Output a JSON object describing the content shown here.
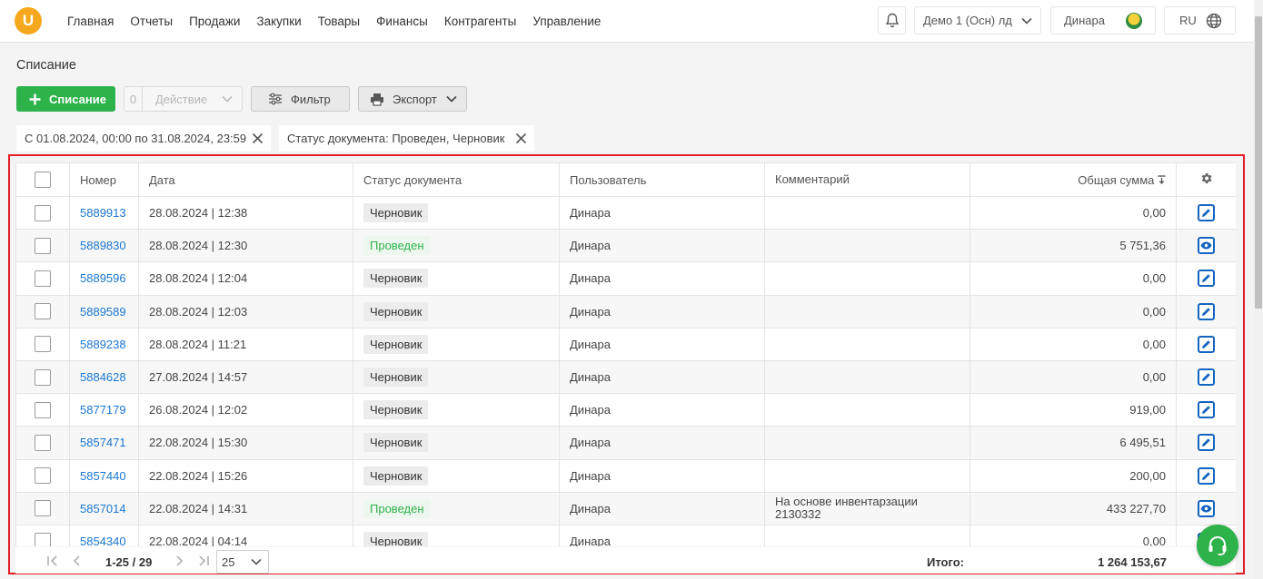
{
  "nav": [
    "Главная",
    "Отчеты",
    "Продажи",
    "Закупки",
    "Товары",
    "Финансы",
    "Контрагенты",
    "Управление"
  ],
  "header": {
    "logo": "U",
    "company": "Демо 1 (Осн) лд",
    "user": "Динара",
    "lang": "RU"
  },
  "page_title": "Списание",
  "toolbar": {
    "add_label": "Списание",
    "action_count": "0",
    "action_label": "Действие",
    "filter_label": "Фильтр",
    "export_label": "Экспорт"
  },
  "chips": {
    "period": "С 01.08.2024, 00:00 по 31.08.2024, 23:59",
    "status": "Статус документа: Проведен, Черновик"
  },
  "table": {
    "columns": {
      "number": "Номер",
      "date": "Дата",
      "status": "Статус документа",
      "user": "Пользователь",
      "comment": "Комментарий",
      "sum": "Общая сумма"
    },
    "rows": [
      {
        "number": "5889913",
        "date": "28.08.2024 | 12:38",
        "status": "Черновик",
        "status_type": "draft",
        "user": "Динара",
        "comment": "",
        "sum": "0,00",
        "action": "edit"
      },
      {
        "number": "5889830",
        "date": "28.08.2024 | 12:30",
        "status": "Проведен",
        "status_type": "done",
        "user": "Динара",
        "comment": "",
        "sum": "5 751,36",
        "action": "view"
      },
      {
        "number": "5889596",
        "date": "28.08.2024 | 12:04",
        "status": "Черновик",
        "status_type": "draft",
        "user": "Динара",
        "comment": "",
        "sum": "0,00",
        "action": "edit"
      },
      {
        "number": "5889589",
        "date": "28.08.2024 | 12:03",
        "status": "Черновик",
        "status_type": "draft",
        "user": "Динара",
        "comment": "",
        "sum": "0,00",
        "action": "edit"
      },
      {
        "number": "5889238",
        "date": "28.08.2024 | 11:21",
        "status": "Черновик",
        "status_type": "draft",
        "user": "Динара",
        "comment": "",
        "sum": "0,00",
        "action": "edit"
      },
      {
        "number": "5884628",
        "date": "27.08.2024 | 14:57",
        "status": "Черновик",
        "status_type": "draft",
        "user": "Динара",
        "comment": "",
        "sum": "0,00",
        "action": "edit"
      },
      {
        "number": "5877179",
        "date": "26.08.2024 | 12:02",
        "status": "Черновик",
        "status_type": "draft",
        "user": "Динара",
        "comment": "",
        "sum": "919,00",
        "action": "edit"
      },
      {
        "number": "5857471",
        "date": "22.08.2024 | 15:30",
        "status": "Черновик",
        "status_type": "draft",
        "user": "Динара",
        "comment": "",
        "sum": "6 495,51",
        "action": "edit"
      },
      {
        "number": "5857440",
        "date": "22.08.2024 | 15:26",
        "status": "Черновик",
        "status_type": "draft",
        "user": "Динара",
        "comment": "",
        "sum": "200,00",
        "action": "edit"
      },
      {
        "number": "5857014",
        "date": "22.08.2024 | 14:31",
        "status": "Проведен",
        "status_type": "done",
        "user": "Динара",
        "comment": "На основе инвентарзации 2130332",
        "sum": "433 227,70",
        "action": "view"
      },
      {
        "number": "5854340",
        "date": "22.08.2024 | 04:14",
        "status": "Черновик",
        "status_type": "draft",
        "user": "Динара",
        "comment": "",
        "sum": "0,00",
        "action": "edit"
      }
    ]
  },
  "pagination": {
    "range": "1-25 / 29",
    "page_size": "25"
  },
  "total": {
    "label": "Итого:",
    "value": "1 264 153,67"
  },
  "colors": {
    "accent_green": "#2eb24a",
    "link_blue": "#1976d2",
    "highlight_red": "#e01e25",
    "logo_orange": "#f6a81c"
  }
}
